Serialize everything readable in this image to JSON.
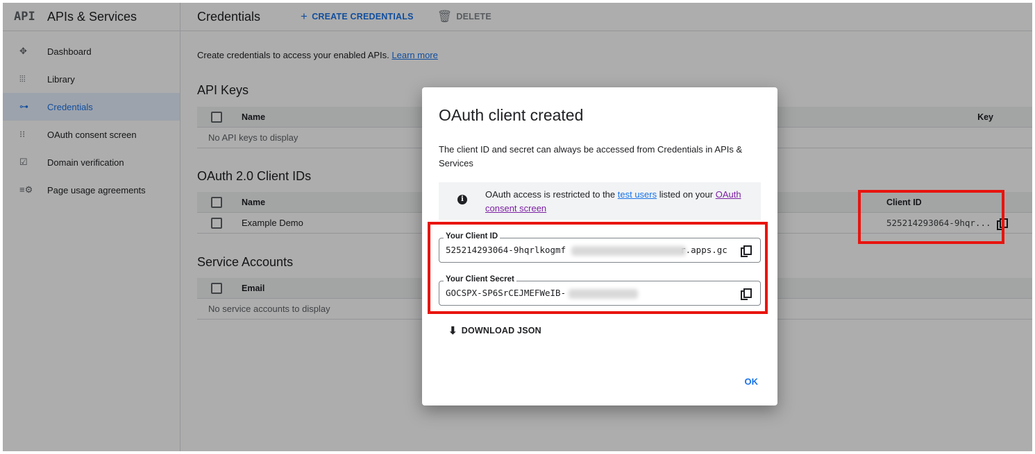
{
  "sidebar": {
    "logo": "API",
    "title": "APIs & Services",
    "items": [
      {
        "label": "Dashboard",
        "icon": "✥"
      },
      {
        "label": "Library",
        "icon": "⦙⦙⦙"
      },
      {
        "label": "Credentials",
        "icon": "⊶"
      },
      {
        "label": "OAuth consent screen",
        "icon": "⁝⁝"
      },
      {
        "label": "Domain verification",
        "icon": "☑"
      },
      {
        "label": "Page usage agreements",
        "icon": "≡⚙"
      }
    ],
    "active_index": 2
  },
  "header": {
    "title": "Credentials",
    "create_label": "CREATE CREDENTIALS",
    "delete_label": "DELETE"
  },
  "intro": {
    "text": "Create credentials to access your enabled APIs.",
    "link": "Learn more"
  },
  "api_keys": {
    "title": "API Keys",
    "col_name": "Name",
    "col_key": "Key",
    "empty": "No API keys to display"
  },
  "oauth": {
    "title": "OAuth 2.0 Client IDs",
    "col_name": "Name",
    "col_client_id": "Client ID",
    "rows": [
      {
        "name": "Example Demo",
        "client_id": "525214293064-9hqr..."
      }
    ]
  },
  "service_accounts": {
    "title": "Service Accounts",
    "col_email": "Email",
    "empty": "No service accounts to display"
  },
  "dialog": {
    "title": "OAuth client created",
    "text": "The client ID and secret can always be accessed from Credentials in APIs & Services",
    "info_prefix": "OAuth access is restricted to the",
    "info_link1": "test users",
    "info_mid": "listed on your",
    "info_link2": "OAuth consent screen",
    "client_id_label": "Your Client ID",
    "client_id_visible_start": "525214293064-9hqrlkogmf",
    "client_id_visible_end": "r.apps.gc",
    "client_secret_label": "Your Client Secret",
    "client_secret_visible": "GOCSPX-SP6SrCEJMEFWeIB-",
    "download_label": "DOWNLOAD JSON",
    "ok_label": "OK"
  },
  "colors": {
    "accent": "#1a73e8",
    "highlight": "#e8140e"
  }
}
